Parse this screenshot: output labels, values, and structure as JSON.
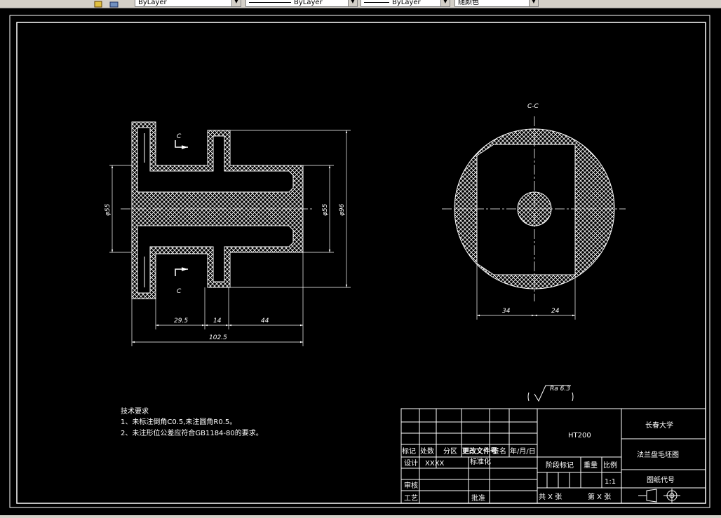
{
  "toolbar": {
    "color_combo": "ByLayer",
    "linetype_combo": "ByLayer",
    "lineweight_combo": "ByLayer",
    "plotstyle_combo": "随颜色"
  },
  "drawing": {
    "left_dims": {
      "d55_left": "φ55",
      "d55_right": "φ55",
      "d96": "φ96",
      "len_29_5": "29.5",
      "len_14": "14",
      "len_44": "44",
      "len_102_5": "102.5",
      "section_mark_top": "C",
      "section_mark_bottom": "C"
    },
    "section_view": {
      "title": "C-C",
      "dim_34": "34",
      "dim_24": "24"
    },
    "roughness": {
      "label": "Ra 6.3"
    },
    "tech_requirements": {
      "title": "技术要求",
      "line1": "1、未标注倒角C0.5,未注圆角R0.5。",
      "line2": "2、未注形位公差应符合GB1184-80的要求。"
    },
    "title_block": {
      "material": "HT200",
      "university": "长春大学",
      "drawing_name": "法兰盘毛坯图",
      "drawing_code_label": "图纸代号",
      "col_mark": "标记",
      "col_count": "处数",
      "col_zone": "分区",
      "col_doc": "更改文件号",
      "col_sign": "签名",
      "col_date": "年/月/日",
      "design_label": "设计",
      "design_value": "XXXX",
      "standard_label": "标准化",
      "stage_label": "阶段标记",
      "weight_label": "重量",
      "scale_label": "比例",
      "scale_value": "1:1",
      "review_label": "审核",
      "process_label": "工艺",
      "approve_label": "批准",
      "sheets_total": "共 X 张",
      "sheet_no": "第 X 张"
    }
  },
  "colors": {
    "background": "#000000",
    "lines": "#ffffff",
    "toolbar": "#d4d0c8"
  }
}
